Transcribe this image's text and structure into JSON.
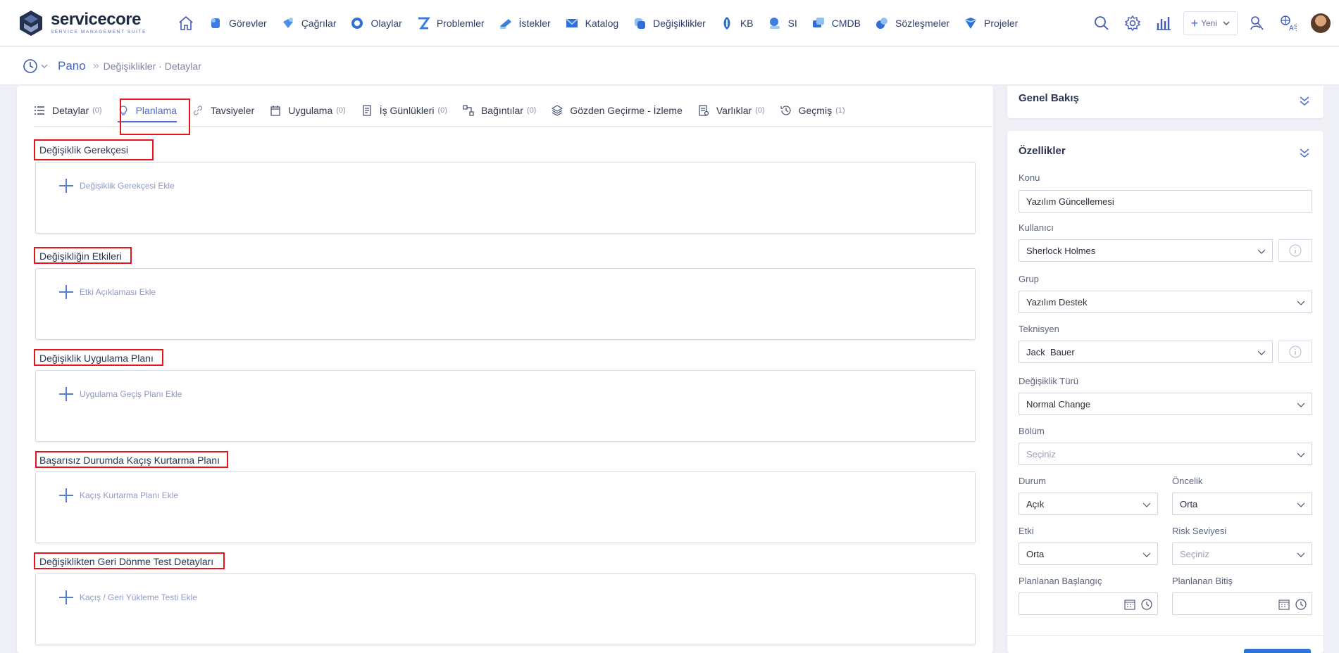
{
  "brand": {
    "name": "servicecore",
    "tagline": "SERVICE MANAGEMENT SUITE"
  },
  "nav": {
    "items": [
      {
        "label": "Görevler",
        "icon": "tasks-icon"
      },
      {
        "label": "Çağrılar",
        "icon": "calls-icon"
      },
      {
        "label": "Olaylar",
        "icon": "incidents-icon"
      },
      {
        "label": "Problemler",
        "icon": "problems-icon"
      },
      {
        "label": "İstekler",
        "icon": "requests-icon"
      },
      {
        "label": "Katalog",
        "icon": "catalog-icon"
      },
      {
        "label": "Değişiklikler",
        "icon": "changes-icon"
      },
      {
        "label": "KB",
        "icon": "kb-icon"
      },
      {
        "label": "SI",
        "icon": "si-icon"
      },
      {
        "label": "CMDB",
        "icon": "cmdb-icon"
      },
      {
        "label": "Sözleşmeler",
        "icon": "contracts-icon"
      },
      {
        "label": "Projeler",
        "icon": "projects-icon"
      }
    ],
    "new_label": "Yeni"
  },
  "breadcrumb": {
    "root": "Pano",
    "rest": "Değişiklikler · Detaylar"
  },
  "tabs": [
    {
      "label": "Detaylar",
      "count": "(0)"
    },
    {
      "label": "Planlama",
      "count": ""
    },
    {
      "label": "Tavsiyeler",
      "count": ""
    },
    {
      "label": "Uygulama",
      "count": "(0)"
    },
    {
      "label": "İş Günlükleri",
      "count": "(0)"
    },
    {
      "label": "Bağıntılar",
      "count": "(0)"
    },
    {
      "label": "Gözden Geçirme - İzleme",
      "count": ""
    },
    {
      "label": "Varlıklar",
      "count": "(0)"
    },
    {
      "label": "Geçmiş",
      "count": "(1)"
    }
  ],
  "sections": [
    {
      "title": "Değişiklik Gerekçesi",
      "add": "Değişiklik Gerekçesi Ekle"
    },
    {
      "title": "Değişikliğin Etkileri",
      "add": "Etki Açıklaması Ekle"
    },
    {
      "title": "Değişiklik Uygulama Planı",
      "add": "Uygulama Geçiş Planı Ekle"
    },
    {
      "title": "Başarısız Durumda Kaçış Kurtarma Planı",
      "add": "Kaçış Kurtarma Planı Ekle"
    },
    {
      "title": "Değişiklikten Geri Dönme Test Detayları",
      "add": "Kaçış / Geri Yükleme Testi Ekle"
    }
  ],
  "overview": {
    "title": "Genel Bakış"
  },
  "properties": {
    "title": "Özellikler",
    "konu": {
      "label": "Konu",
      "value": "Yazılım Güncellemesi"
    },
    "kullanici": {
      "label": "Kullanıcı",
      "value": "Sherlock Holmes"
    },
    "grup": {
      "label": "Grup",
      "value": "Yazılım Destek"
    },
    "teknisyen": {
      "label": "Teknisyen",
      "value": "Jack  Bauer"
    },
    "tur": {
      "label": "Değişiklik Türü",
      "value": "Normal Change"
    },
    "bolum": {
      "label": "Bölüm",
      "placeholder": "Seçiniz"
    },
    "durum": {
      "label": "Durum",
      "value": "Açık"
    },
    "oncelik": {
      "label": "Öncelik",
      "value": "Orta"
    },
    "etki": {
      "label": "Etki",
      "value": "Orta"
    },
    "risk": {
      "label": "Risk Seviyesi",
      "placeholder": "Seçiniz"
    },
    "baslangic": {
      "label": "Planlanan Başlangıç",
      "value": ""
    },
    "bitis": {
      "label": "Planlanan Bitiş",
      "value": ""
    }
  },
  "colors": {
    "accent": "#4d6bd0",
    "highlight": "#e8141c",
    "brand_dark": "#1e2a44"
  }
}
